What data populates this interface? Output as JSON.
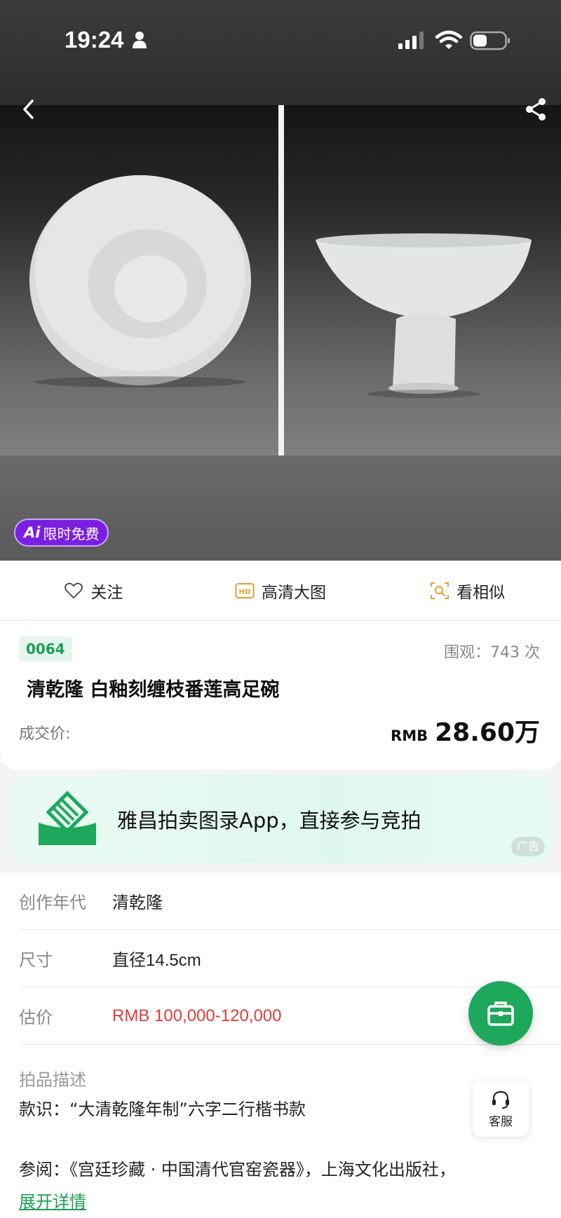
{
  "status_bar": {
    "time": "19:24"
  },
  "hero": {
    "ai_badge_mark": "Ai",
    "ai_badge_label": "限时免费"
  },
  "actions": [
    {
      "label": "关注",
      "icon": "heart-icon"
    },
    {
      "label": "高清大图",
      "icon": "hd-icon"
    },
    {
      "label": "看相似",
      "icon": "image-search-icon"
    }
  ],
  "lot": {
    "number": "0064",
    "views": "围观：743 次",
    "title": "清乾隆 白釉刻缠枝番莲高足碗",
    "price_label": "成交价:",
    "price_currency": "RMB",
    "price_value": "28.60万"
  },
  "ad": {
    "text": "雅昌拍卖图录App，直接参与竞拍",
    "tag": "广告"
  },
  "details": {
    "rows": [
      {
        "label": "创作年代",
        "value": "清乾隆"
      },
      {
        "label": "尺寸",
        "value": "直径14.5cm"
      },
      {
        "label": "估价",
        "value": "RMB  100,000-120,000"
      }
    ],
    "desc_label": "拍品描述",
    "desc_line1": "款识：“大清乾隆年制”六字二行楷书款",
    "desc_line2": "参阅：《宫廷珍藏 · 中国清代官窑瓷器》，上海文化出版社，",
    "expand": "展开详情"
  },
  "floating": {
    "service_label": "客服"
  },
  "colors": {
    "accent_green": "#1ea85b",
    "estimate_red": "#e33b3b",
    "ai_purple": "#7a1fe0"
  }
}
